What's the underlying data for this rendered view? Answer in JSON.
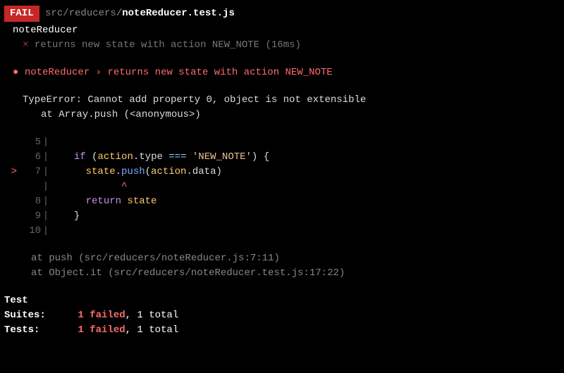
{
  "header": {
    "badge": "FAIL",
    "path_prefix": "src/reducers/",
    "path_file": "noteReducer.test.js"
  },
  "suite": {
    "name": "noteReducer",
    "fail_marker": "×",
    "test_title": "returns new state with action NEW_NOTE",
    "timing": "(16ms)"
  },
  "bullet": {
    "dot": "●",
    "suite": "noteReducer",
    "sep": "›",
    "test": "returns new state with action NEW_NOTE"
  },
  "error": {
    "message": "TypeError: Cannot add property 0, object is not extensible",
    "at_line": "at Array.push (<anonymous>)"
  },
  "code": {
    "lines": [
      {
        "n": "5",
        "chevron": false,
        "content_type": "empty"
      },
      {
        "n": "6",
        "chevron": false,
        "content_type": "if_line",
        "tokens": {
          "kw": "if",
          "obj": "action",
          "dot": ".",
          "prop": "type",
          "op": "===",
          "str": "'NEW_NOTE'",
          "brace": ") {"
        }
      },
      {
        "n": "7",
        "chevron": true,
        "content_type": "push_line",
        "tokens": {
          "obj1": "state",
          "dot1": ".",
          "fn": "push",
          "paren": "(",
          "obj2": "action",
          "dot2": ".",
          "prop": "data",
          "paren2": ")"
        }
      },
      {
        "n": "",
        "chevron": false,
        "content_type": "caret"
      },
      {
        "n": "8",
        "chevron": false,
        "content_type": "return_line",
        "tokens": {
          "kw": "return",
          "obj": "state"
        }
      },
      {
        "n": "9",
        "chevron": false,
        "content_type": "close_brace"
      },
      {
        "n": "10",
        "chevron": false,
        "content_type": "empty"
      }
    ],
    "caret": "^"
  },
  "bottom_stack": [
    "at push (src/reducers/noteReducer.js:7:11)",
    "at Object.it (src/reducers/noteReducer.test.js:17:22)"
  ],
  "summary": {
    "suites_label": "Test Suites:",
    "suites_failed": "1 failed",
    "suites_total": ", 1 total",
    "tests_label": "Tests:",
    "tests_failed": "1 failed",
    "tests_total": ", 1 total"
  }
}
